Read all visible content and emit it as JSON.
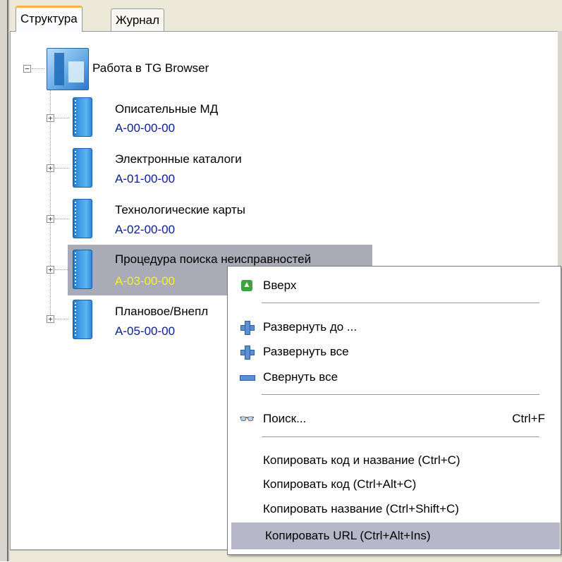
{
  "tabs": [
    "Структура",
    "Журнал"
  ],
  "tree": {
    "root": {
      "title": "Работа в TG Browser",
      "expander": "−"
    },
    "nodes": [
      {
        "title": "Описательные МД",
        "code": "A-00-00-00",
        "expander": "+"
      },
      {
        "title": "Электронные каталоги",
        "code": "A-01-00-00",
        "expander": "+"
      },
      {
        "title": "Технологические карты",
        "code": "A-02-00-00",
        "expander": "+"
      },
      {
        "title": "Процедура поиска неисправностей",
        "code": "A-03-00-00",
        "expander": "+",
        "selected": true
      },
      {
        "title": "Плановое/Внепл",
        "code": "A-05-00-00",
        "expander": "+"
      }
    ]
  },
  "context_menu": {
    "items": [
      {
        "label": "Вверх",
        "icon": "up-arrow-icon"
      },
      {
        "label": "Развернуть до ...",
        "icon": "expand-to-icon"
      },
      {
        "label": "Развернуть все",
        "icon": "expand-all-icon"
      },
      {
        "label": "Свернуть все",
        "icon": "collapse-all-icon"
      },
      {
        "label": "Поиск...",
        "shortcut": "Ctrl+F",
        "icon": "binoculars-icon"
      },
      {
        "label": "Копировать код и название (Ctrl+C)"
      },
      {
        "label": "Копировать код (Ctrl+Alt+C)"
      },
      {
        "label": "Копировать название (Ctrl+Shift+C)"
      },
      {
        "label": "Копировать URL (Ctrl+Alt+Ins)",
        "highlighted": true
      }
    ]
  },
  "colors": {
    "selection": "#a9acb6",
    "selected_code": "#f6f21c",
    "code_text": "#0a1d8f",
    "menu_hover": "#b6b7c9",
    "active_tab_accent": "#f6b542"
  }
}
